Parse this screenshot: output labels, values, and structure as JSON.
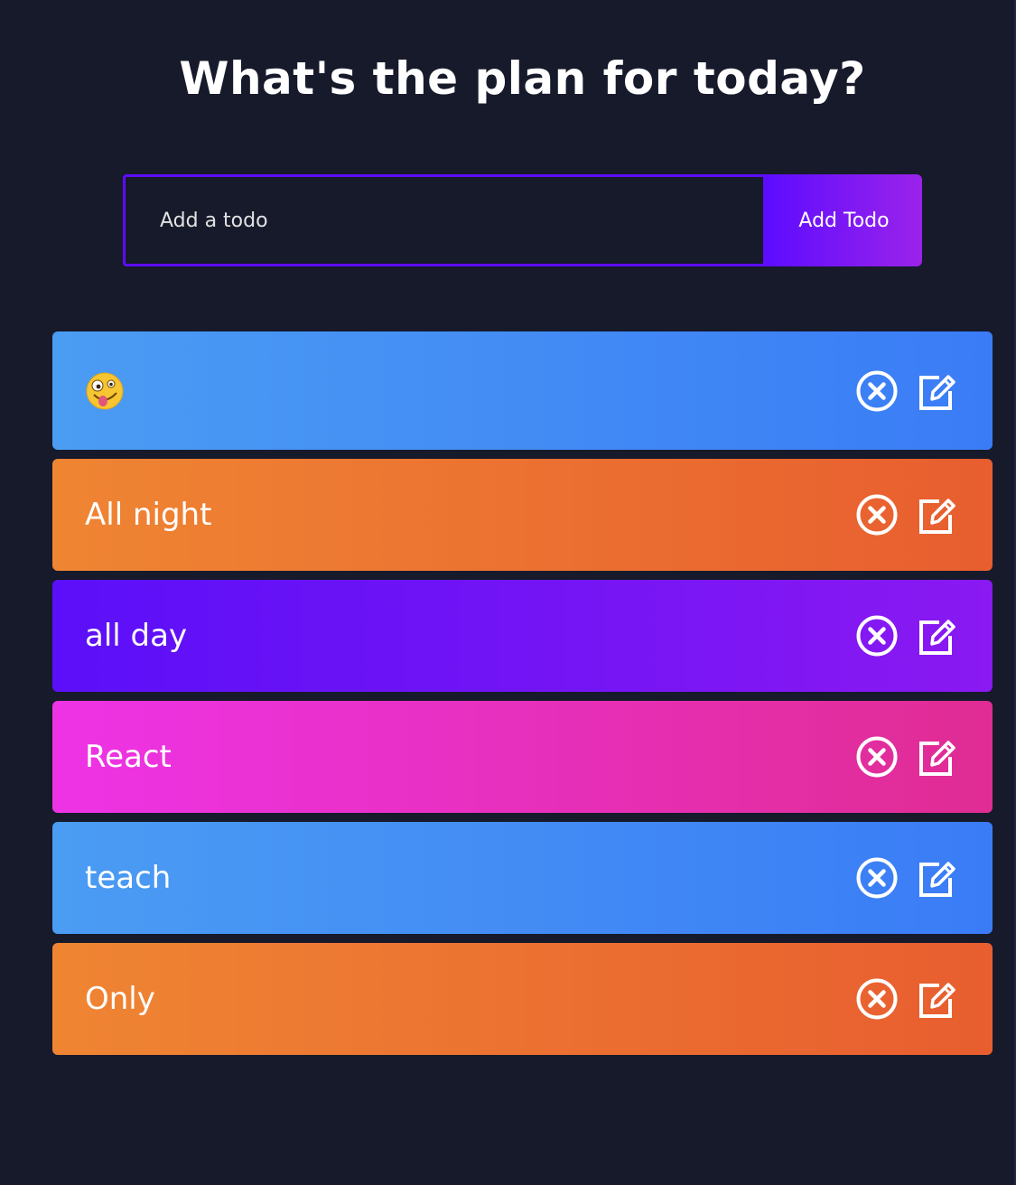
{
  "header": {
    "title": "What's the plan for today?"
  },
  "form": {
    "placeholder": "Add a todo",
    "value": "",
    "button_label": "Add Todo"
  },
  "colors": {
    "background": "#161a2b",
    "accent": "#5d0cff",
    "accent_end": "#9b23ea",
    "blue": "#4b9cf3",
    "orange": "#ef8533",
    "purple": "#5b0ff8",
    "pink": "#ee33e6"
  },
  "todos": [
    {
      "text": "",
      "icon": "zany-face-emoji-icon",
      "color": "blue"
    },
    {
      "text": "All night",
      "color": "orange"
    },
    {
      "text": "all day",
      "color": "purple"
    },
    {
      "text": "React",
      "color": "pink"
    },
    {
      "text": "teach",
      "color": "blue"
    },
    {
      "text": "Only",
      "color": "orange"
    }
  ],
  "row_icons": {
    "delete": "circle-x-icon",
    "edit": "edit-pencil-icon"
  }
}
